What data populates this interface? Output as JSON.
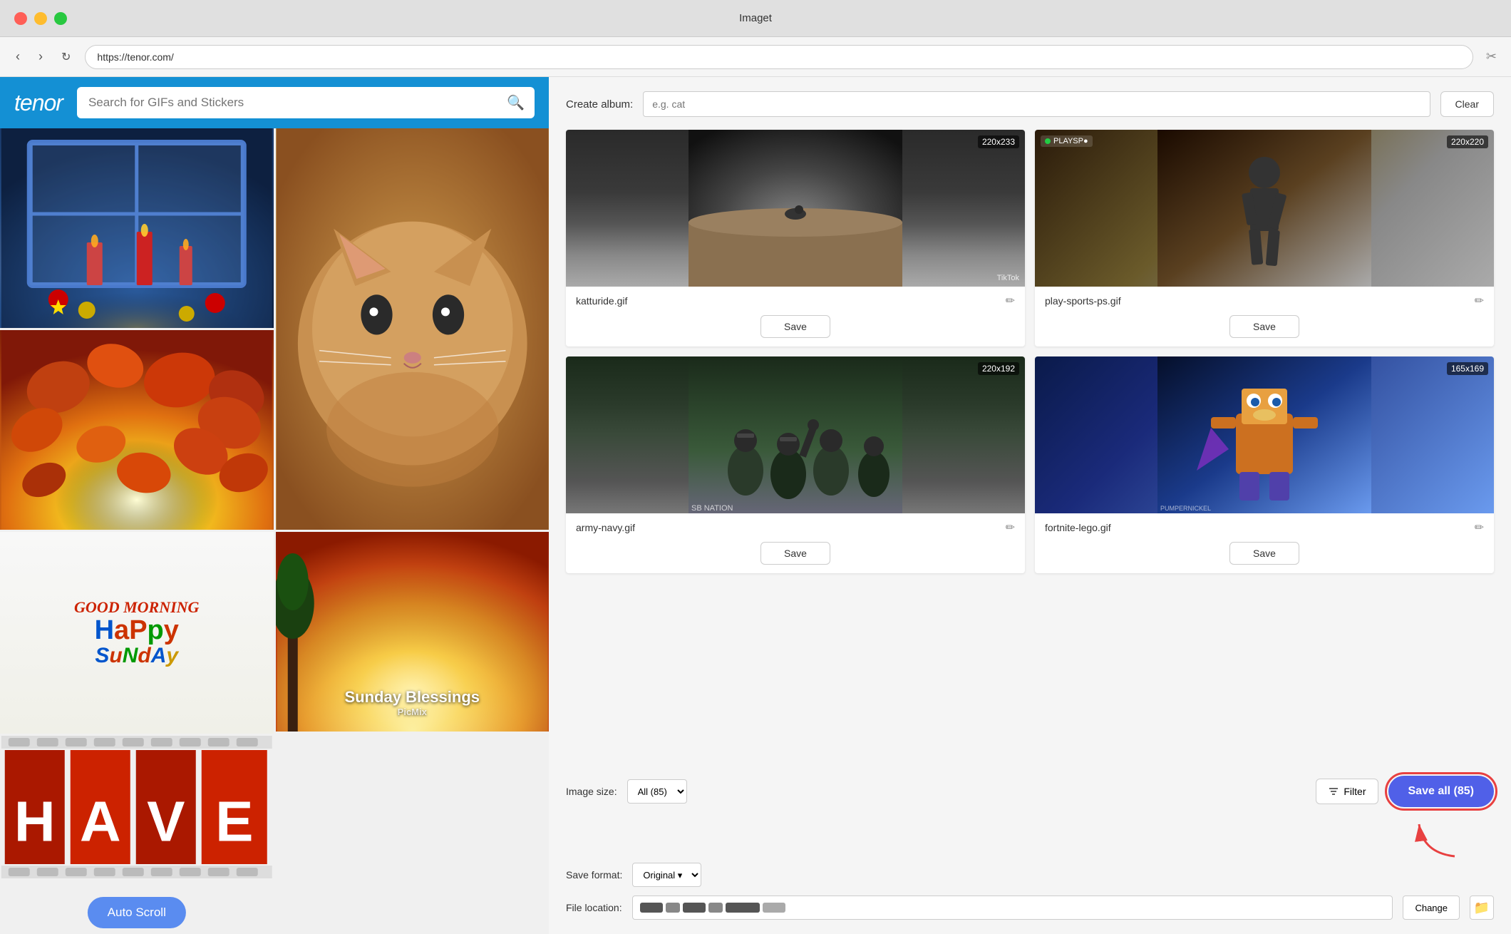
{
  "app": {
    "title": "Imaget",
    "url": "https://tenor.com/"
  },
  "titlebar": {
    "close_label": "×",
    "minimize_label": "–",
    "maximize_label": "+"
  },
  "tenor": {
    "logo": "tenor",
    "search_placeholder": "Search for GIFs and Stickers"
  },
  "toolbar": {
    "back_label": "‹",
    "forward_label": "›",
    "refresh_label": "↻",
    "bookmark_label": "🔖"
  },
  "right_panel": {
    "create_album_label": "Create album:",
    "album_placeholder": "e.g. cat",
    "clear_label": "Clear",
    "images": [
      {
        "filename": "katturide.gif",
        "size": "220x233",
        "save_label": "Save",
        "watermark": "TikTok",
        "style": "katturide"
      },
      {
        "filename": "play-sports-ps.gif",
        "size": "220x220",
        "save_label": "Save",
        "badge": "PLAYSP●",
        "style": "playsports"
      },
      {
        "filename": "army-navy.gif",
        "size": "220x192",
        "save_label": "Save",
        "watermark": "SB NATION",
        "style": "armynavy"
      },
      {
        "filename": "fortnite-lego.gif",
        "size": "165x169",
        "save_label": "Save",
        "watermark": "PUMPERNICKEL",
        "style": "fortnitelego"
      }
    ],
    "bottom": {
      "image_size_label": "Image size:",
      "size_option": "All (85)",
      "filter_label": "Filter",
      "save_all_label": "Save all (85)",
      "save_format_label": "Save format:",
      "format_option": "Original",
      "file_location_label": "File location:",
      "change_label": "Change"
    }
  },
  "gifs": {
    "auto_scroll": "Auto Scroll",
    "good_morning": "GOOD MORNING",
    "happy": "HaPpy",
    "sunday": "SuNdAy",
    "sunday_blessings": "Sunday Blessings",
    "picmix": "PicMix"
  }
}
